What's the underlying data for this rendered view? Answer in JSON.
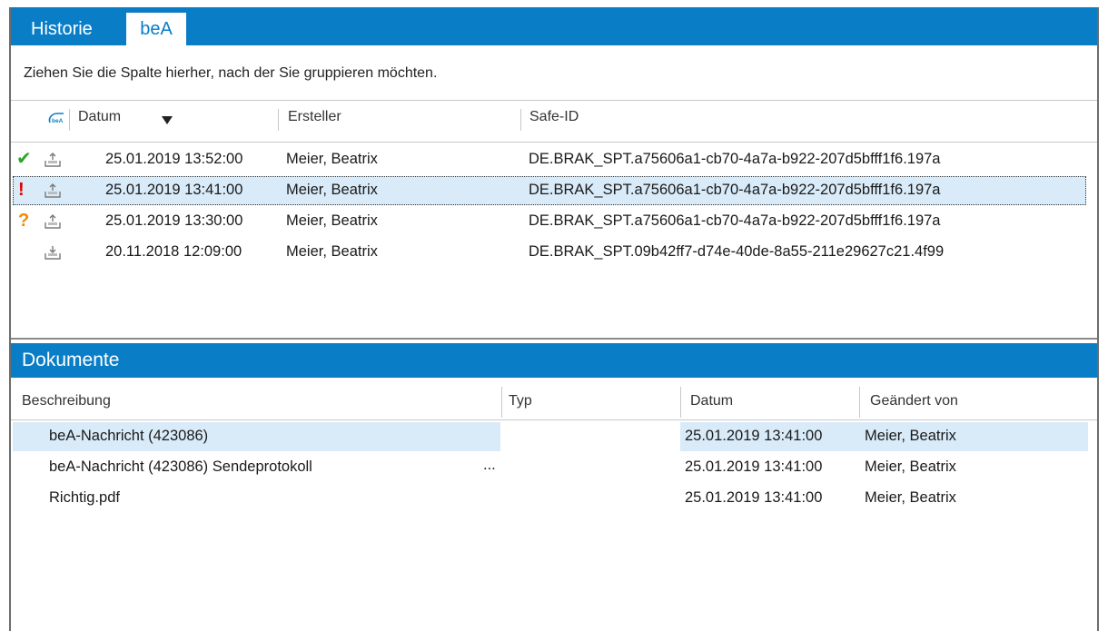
{
  "tabs": {
    "inactive_label": "Historie",
    "active_label": "beA"
  },
  "history": {
    "group_hint": "Ziehen Sie die Spalte hierher, nach der Sie gruppieren möchten.",
    "columns": {
      "bea_icon": "beA",
      "datum": "Datum",
      "ersteller": "Ersteller",
      "safe_id": "Safe-ID"
    },
    "rows": [
      {
        "status": "✔",
        "status_color": "#2aa52a",
        "direction": "outgoing",
        "datum": "25.01.2019 13:52:00",
        "ersteller": "Meier, Beatrix",
        "safe_id": "DE.BRAK_SPT.a75606a1-cb70-4a7a-b922-207d5bfff1f6.197a"
      },
      {
        "status": "!",
        "status_color": "#e00000",
        "direction": "outgoing",
        "datum": "25.01.2019 13:41:00",
        "ersteller": "Meier, Beatrix",
        "safe_id": "DE.BRAK_SPT.a75606a1-cb70-4a7a-b922-207d5bfff1f6.197a"
      },
      {
        "status": "?",
        "status_color": "#f08a00",
        "direction": "outgoing",
        "datum": "25.01.2019 13:30:00",
        "ersteller": "Meier, Beatrix",
        "safe_id": "DE.BRAK_SPT.a75606a1-cb70-4a7a-b922-207d5bfff1f6.197a"
      },
      {
        "status": "",
        "status_color": "#000000",
        "direction": "incoming",
        "datum": "20.11.2018 12:09:00",
        "ersteller": "Meier, Beatrix",
        "safe_id": "DE.BRAK_SPT.09b42ff7-d74e-40de-8a55-211e29627c21.4f99"
      }
    ]
  },
  "documents": {
    "title": "Dokumente",
    "columns": {
      "beschreibung": "Beschreibung",
      "typ": "Typ",
      "datum": "Datum",
      "geaendert_von": "Geändert von"
    },
    "rows": [
      {
        "beschreibung": "beA-Nachricht (423086)",
        "typ": "",
        "datum": "25.01.2019 13:41:00",
        "geaendert_von": "Meier, Beatrix"
      },
      {
        "beschreibung": "beA-Nachricht (423086) Sendeprotokoll",
        "typ": "...",
        "datum": "25.01.2019 13:41:00",
        "geaendert_von": "Meier, Beatrix"
      },
      {
        "beschreibung": "Richtig.pdf",
        "typ": "",
        "datum": "25.01.2019 13:41:00",
        "geaendert_von": "Meier, Beatrix"
      }
    ]
  },
  "colors": {
    "accent": "#0a7dc7",
    "selection": "#d9ebf9"
  }
}
